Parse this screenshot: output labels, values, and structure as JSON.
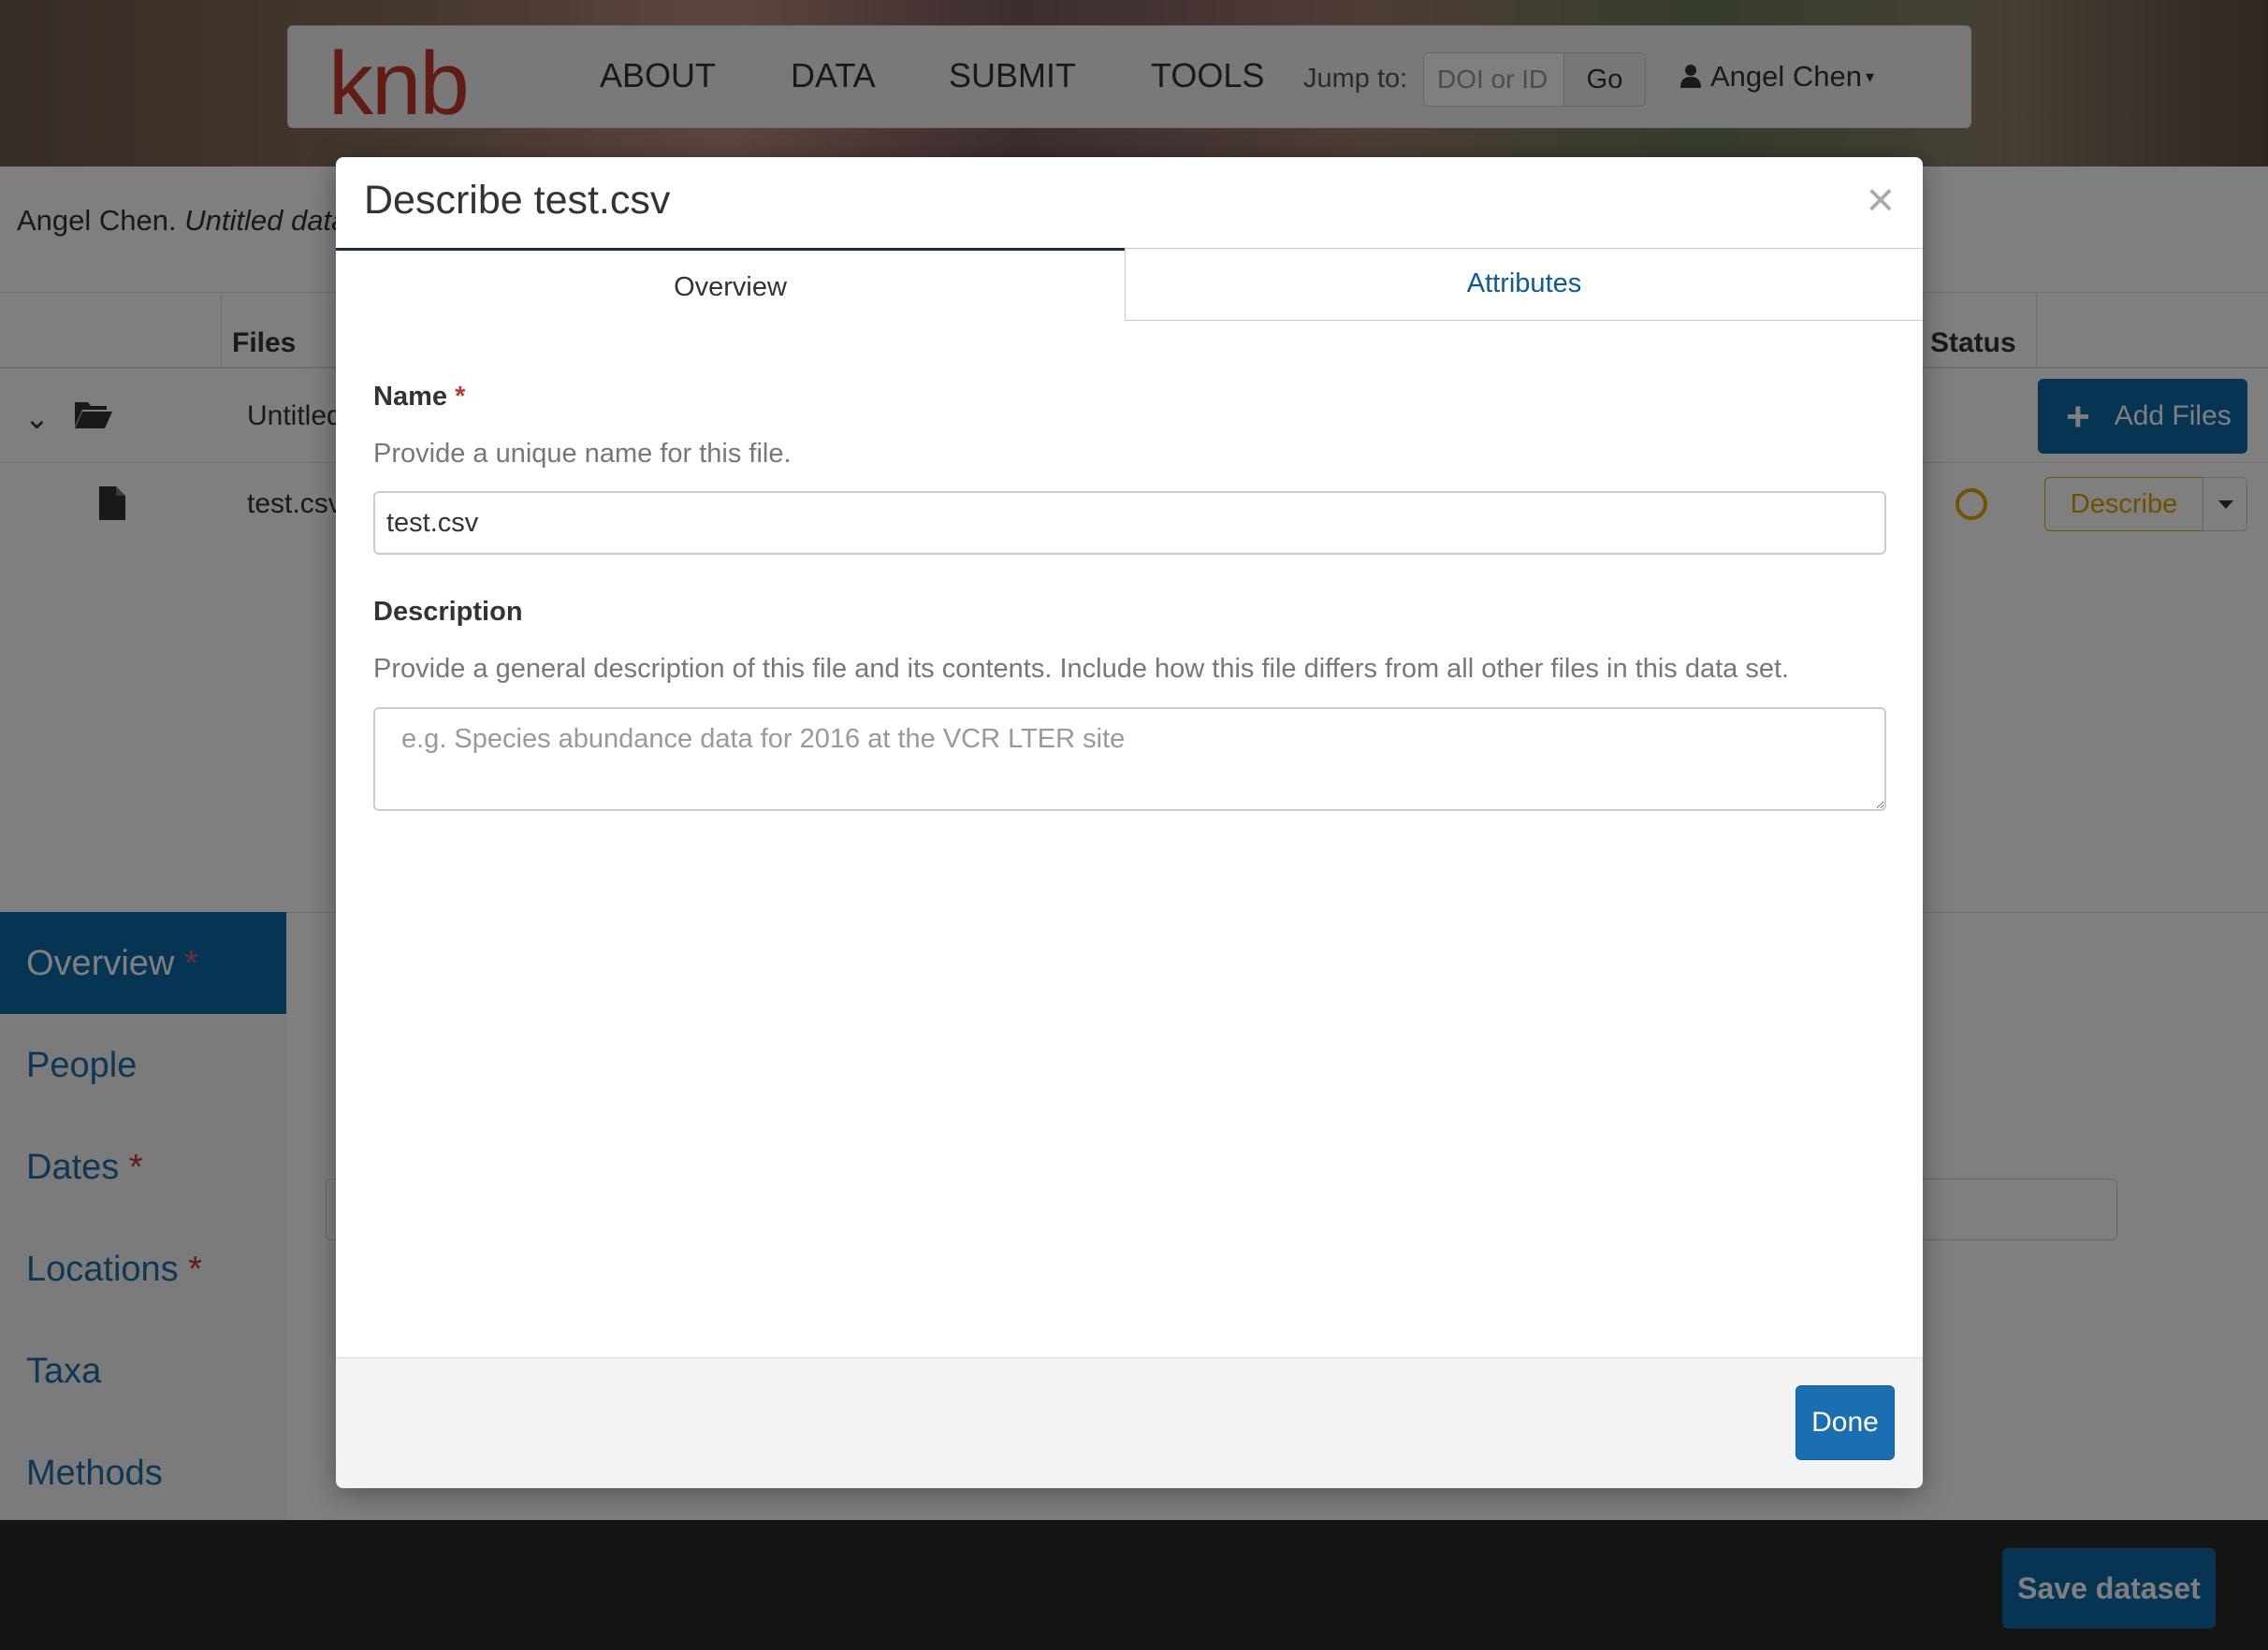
{
  "navbar": {
    "brand": "knb",
    "links": [
      "ABOUT",
      "DATA",
      "SUBMIT",
      "TOOLS"
    ],
    "jump_label": "Jump to:",
    "jump_placeholder": "DOI or ID",
    "go_label": "Go",
    "user_name": "Angel Chen"
  },
  "citation": {
    "author": "Angel Chen.",
    "title_partial": "Untitled data"
  },
  "files_table": {
    "headers": {
      "files": "Files",
      "status": "Status"
    },
    "rows": [
      {
        "name": "Untitled",
        "type": "folder"
      },
      {
        "name": "test.csv",
        "type": "file"
      }
    ],
    "add_files_label": "Add Files",
    "describe_label": "Describe"
  },
  "sidenav": {
    "items": [
      {
        "label": "Overview",
        "required": true
      },
      {
        "label": "People",
        "required": false
      },
      {
        "label": "Dates",
        "required": true
      },
      {
        "label": "Locations",
        "required": true
      },
      {
        "label": "Taxa",
        "required": false
      },
      {
        "label": "Methods",
        "required": false
      }
    ]
  },
  "footer": {
    "save_label": "Save dataset"
  },
  "modal": {
    "title": "Describe test.csv",
    "close_symbol": "×",
    "tabs": [
      "Overview",
      "Attributes"
    ],
    "name_label": "Name",
    "required_mark": "*",
    "name_help": "Provide a unique name for this file.",
    "name_value": "test.csv",
    "description_label": "Description",
    "description_help": "Provide a general description of this file and its contents. Include how this file differs from all other files in this data set.",
    "description_placeholder": "e.g. Species abundance data for 2016 at the VCR LTER site",
    "done_label": "Done"
  },
  "colors": {
    "primary": "#1a6fb3",
    "brand": "#c0392b",
    "required": "#c0392b",
    "status_pending": "#e0a800"
  }
}
